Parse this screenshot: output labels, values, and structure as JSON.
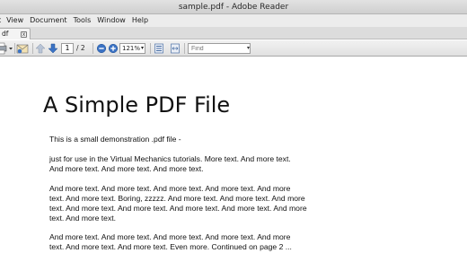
{
  "window": {
    "title": "sample.pdf - Adobe Reader"
  },
  "menubar": {
    "items": [
      "t",
      "View",
      "Document",
      "Tools",
      "Window",
      "Help"
    ]
  },
  "tabs": [
    {
      "label": "df",
      "close": "x"
    }
  ],
  "toolbar": {
    "page_current": "1",
    "page_total": "/ 2",
    "zoom": "121%",
    "find_placeholder": "Find"
  },
  "document": {
    "title": "A Simple PDF File",
    "paragraphs": [
      "This is a small demonstration .pdf file -",
      "just for use in the Virtual Mechanics tutorials. More text. And more text. And more text. And more text. And more text.",
      "And more text. And more text. And more text. And more text. And more text. And more text. Boring, zzzzz. And more text. And more text. And more text. And more text. And more text. And more text. And more text. And more text. And more text.",
      "And more text. And more text. And more text. And more text. And more text. And more text. And more text. Even more. Continued on page 2 ..."
    ]
  },
  "colors": {
    "arrow_blue": "#3b72c4",
    "toolbar_bg": "#e8e8e8",
    "page_bg": "#ffffff"
  },
  "icons": [
    "print-icon",
    "email-icon",
    "prev-page-icon",
    "next-page-icon",
    "zoom-out-icon",
    "zoom-in-icon",
    "fit-page-icon",
    "fit-width-icon",
    "find-dropdown-icon"
  ]
}
